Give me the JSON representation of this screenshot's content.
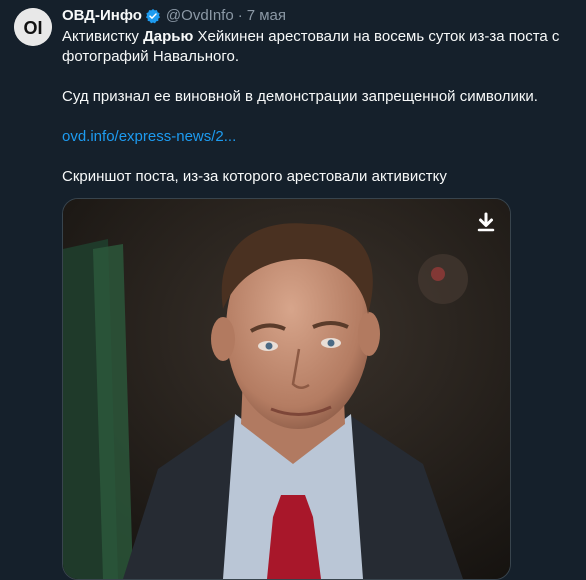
{
  "tweet": {
    "avatar_text": "OI",
    "display_name": "ОВД-Инфо",
    "handle": "@OvdInfo",
    "separator": "·",
    "time": "7 мая",
    "text": {
      "p1_a": "Активистку ",
      "p1_bold": "Дарью",
      "p1_b": " Хейкинен арестовали на восемь суток из-за поста с",
      "p1_c": "фотографий Навального.",
      "p2": "Суд признал ее виновной в демонстрации запрещенной символики.",
      "link": "ovd.info/express-news/2...",
      "p3": "Скриншот поста, из-за которого арестовали активистку"
    },
    "media": {
      "icon": "download-arrow-icon"
    }
  },
  "colors": {
    "background": "#15202b",
    "text": "#f7f9f9",
    "secondary": "#8b98a5",
    "link": "#1d9bf0",
    "verified": "#1d9bf0"
  }
}
